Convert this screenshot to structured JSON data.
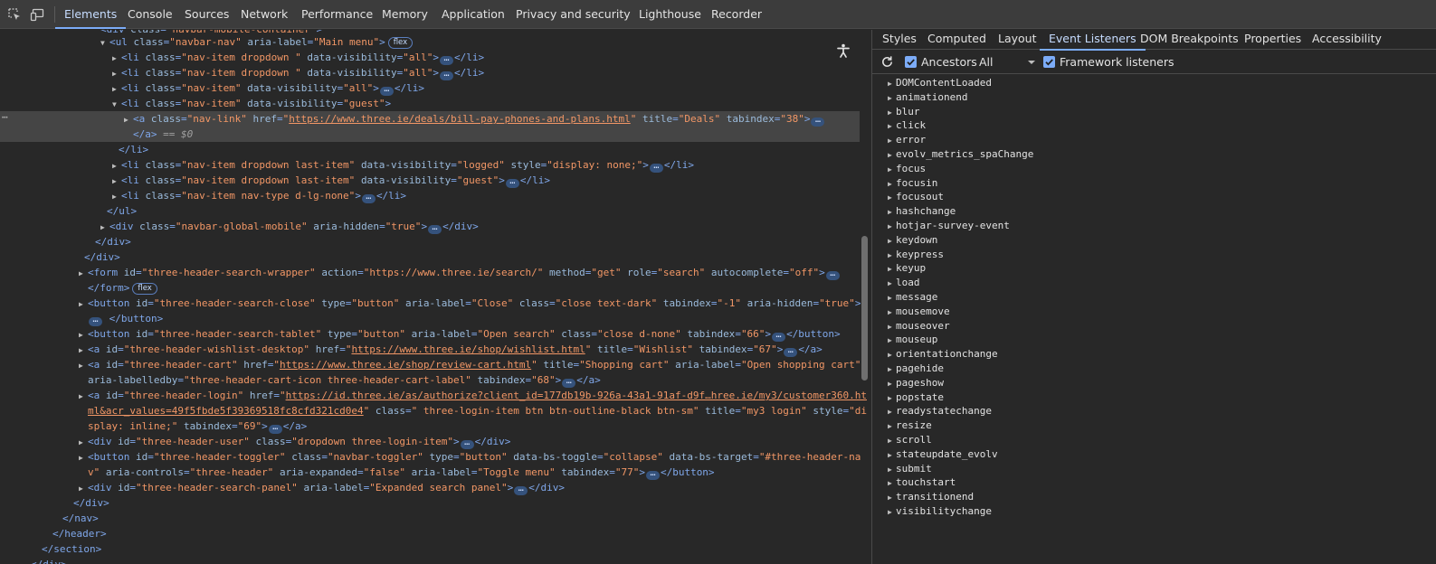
{
  "toolbar": {
    "inspect_icon": "inspect-element-icon",
    "device_icon": "device-toolbar-icon"
  },
  "tabs": [
    {
      "label": "Elements",
      "active": true
    },
    {
      "label": "Console"
    },
    {
      "label": "Sources"
    },
    {
      "label": "Network"
    },
    {
      "label": "Performance"
    },
    {
      "label": "Memory"
    },
    {
      "label": "Application"
    },
    {
      "label": "Privacy and security"
    },
    {
      "label": "Lighthouse"
    },
    {
      "label": "Recorder"
    }
  ],
  "dom": {
    "row0_text": "<div class=\"navbar-mobile-container\">",
    "badges": {
      "flex": "flex"
    },
    "selected_ref": "== $0",
    "urls": {
      "deals": "https://www.three.ie/deals/bill-pay-phones-and-plans.html",
      "search": "https://www.three.ie/search/",
      "wishlist": "https://www.three.ie/shop/wishlist.html",
      "cart": "https://www.three.ie/shop/review-cart.html",
      "login1": "https://id.three.ie/as/authorize?client_id=177db19b-926a-43a1-91af-d9f…hree.ie/my3/customer360.ht",
      "login2": "ml&acr_values=49f5fbde5f39369518fc8cfd321cd0e4"
    }
  },
  "side": {
    "tabs": [
      {
        "label": "Styles"
      },
      {
        "label": "Computed"
      },
      {
        "label": "Layout"
      },
      {
        "label": "Event Listeners",
        "active": true
      },
      {
        "label": "DOM Breakpoints"
      },
      {
        "label": "Properties"
      },
      {
        "label": "Accessibility"
      }
    ],
    "ancestors_label": "Ancestors",
    "ancestors_checked": true,
    "filter_value": "All",
    "framework_label": "Framework listeners",
    "framework_checked": true,
    "events": [
      "DOMContentLoaded",
      "animationend",
      "blur",
      "click",
      "error",
      "evolv_metrics_spaChange",
      "focus",
      "focusin",
      "focusout",
      "hashchange",
      "hotjar-survey-event",
      "keydown",
      "keypress",
      "keyup",
      "load",
      "message",
      "mousemove",
      "mouseover",
      "mouseup",
      "orientationchange",
      "pagehide",
      "pageshow",
      "popstate",
      "readystatechange",
      "resize",
      "scroll",
      "stateupdate_evolv",
      "submit",
      "touchstart",
      "transitionend",
      "visibilitychange"
    ]
  },
  "colors": {
    "background": "#282828",
    "tag": "#7fa7ea",
    "attr_name": "#9bbbdc",
    "attr_value": "#f29766",
    "accent": "#7cacf8"
  }
}
